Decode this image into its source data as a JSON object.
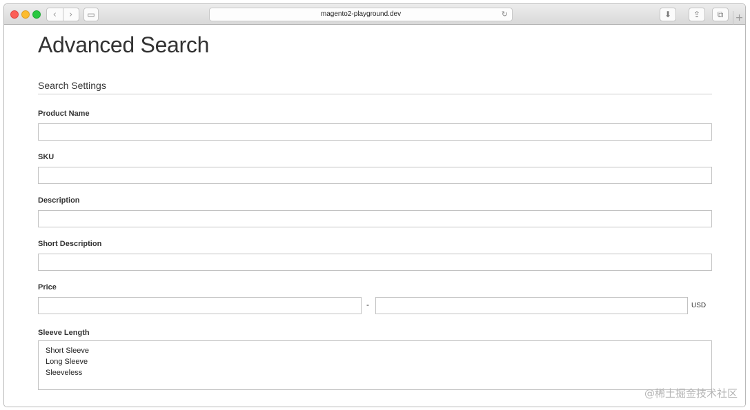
{
  "browser": {
    "url": "magento2-playground.dev",
    "back_icon": "‹",
    "forward_icon": "›",
    "sidebar_icon": "▭",
    "reload_icon": "↻",
    "download_icon": "⬇",
    "share_icon": "⇪",
    "tabs_icon": "⧉",
    "newtab_icon": "+"
  },
  "page": {
    "title": "Advanced Search",
    "section_legend": "Search Settings"
  },
  "form": {
    "product_name": {
      "label": "Product Name",
      "value": ""
    },
    "sku": {
      "label": "SKU",
      "value": ""
    },
    "description": {
      "label": "Description",
      "value": ""
    },
    "short_description": {
      "label": "Short Description",
      "value": ""
    },
    "price": {
      "label": "Price",
      "from": "",
      "to": "",
      "separator": "-",
      "currency": "USD"
    },
    "sleeve_length": {
      "label": "Sleeve Length",
      "options": [
        "Short Sleeve",
        "Long Sleeve",
        "Sleeveless"
      ]
    }
  },
  "watermark": "@稀土掘金技术社区",
  "colors": {
    "traffic_red": "#fc5f57",
    "traffic_yellow": "#fdbc2e",
    "traffic_green": "#28c840"
  }
}
